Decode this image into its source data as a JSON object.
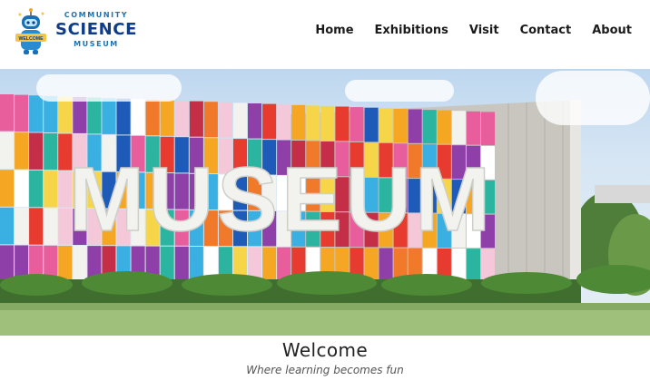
{
  "logo": {
    "top": "COMMUNITY",
    "main": "SCIENCE",
    "bottom": "MUSEUM",
    "badge": "WELCOME"
  },
  "nav": {
    "items": [
      {
        "label": "Home",
        "active": true
      },
      {
        "label": "Exhibitions",
        "active": false
      },
      {
        "label": "Visit",
        "active": false
      },
      {
        "label": "Contact",
        "active": false
      },
      {
        "label": "About",
        "active": false
      }
    ]
  },
  "hero": {
    "sign_text": "MUSEUM"
  },
  "welcome": {
    "title": "Welcome",
    "subtitle": "Where learning becomes fun"
  },
  "colors": {
    "brand_blue": "#0e3d86",
    "accent_teal": "#5fe3d1"
  }
}
